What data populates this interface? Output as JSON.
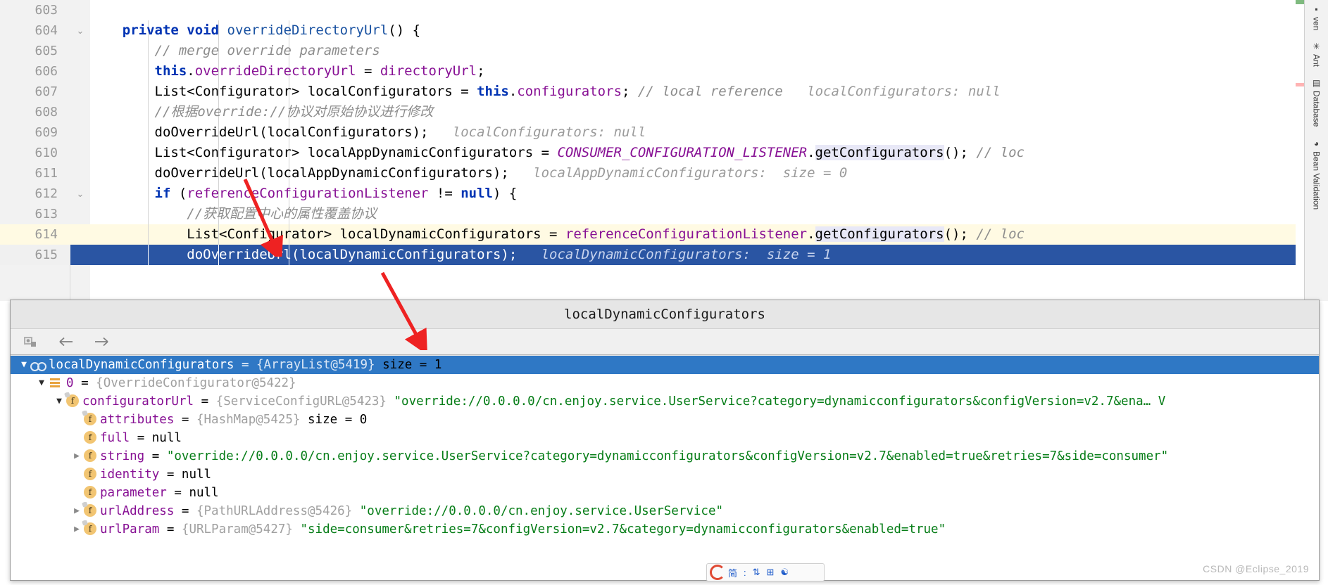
{
  "editor": {
    "lines": [
      {
        "num": "603",
        "state": "none",
        "tokens": []
      },
      {
        "num": "604",
        "state": "none",
        "fold": "minus",
        "tokens": [
          {
            "t": "    ",
            "c": "plain"
          },
          {
            "t": "private",
            "c": "kw2"
          },
          {
            "t": " ",
            "c": "plain"
          },
          {
            "t": "void",
            "c": "kw2"
          },
          {
            "t": " ",
            "c": "plain"
          },
          {
            "t": "overrideDirectoryUrl",
            "c": "meth"
          },
          {
            "t": "() {",
            "c": "plain"
          }
        ]
      },
      {
        "num": "605",
        "state": "none",
        "tokens": [
          {
            "t": "        ",
            "c": "plain"
          },
          {
            "t": "// merge override parameters",
            "c": "cmt"
          }
        ]
      },
      {
        "num": "606",
        "state": "none",
        "tokens": [
          {
            "t": "        ",
            "c": "plain"
          },
          {
            "t": "this",
            "c": "kw2"
          },
          {
            "t": ".",
            "c": "plain"
          },
          {
            "t": "overrideDirectoryUrl",
            "c": "fld"
          },
          {
            "t": " = ",
            "c": "plain"
          },
          {
            "t": "directoryUrl",
            "c": "fld"
          },
          {
            "t": ";",
            "c": "plain"
          }
        ]
      },
      {
        "num": "607",
        "state": "none",
        "tokens": [
          {
            "t": "        ",
            "c": "plain"
          },
          {
            "t": "List<Configurator> localConfigurators = ",
            "c": "plain"
          },
          {
            "t": "this",
            "c": "kw2"
          },
          {
            "t": ".",
            "c": "plain"
          },
          {
            "t": "configurators",
            "c": "fld"
          },
          {
            "t": "; ",
            "c": "plain"
          },
          {
            "t": "// local reference",
            "c": "cmt"
          },
          {
            "t": "   localConfigurators: null",
            "c": "hint"
          }
        ]
      },
      {
        "num": "608",
        "state": "none",
        "tokens": [
          {
            "t": "        ",
            "c": "plain"
          },
          {
            "t": "//根据override://协议对原始协议进行修改",
            "c": "cmt"
          }
        ]
      },
      {
        "num": "609",
        "state": "none",
        "tokens": [
          {
            "t": "        ",
            "c": "plain"
          },
          {
            "t": "doOverrideUrl(localConfigurators);",
            "c": "plain"
          },
          {
            "t": "   localConfigurators: null",
            "c": "hint"
          }
        ]
      },
      {
        "num": "610",
        "state": "none",
        "tokens": [
          {
            "t": "        ",
            "c": "plain"
          },
          {
            "t": "List<Configurator> localAppDynamicConfigurators = ",
            "c": "plain"
          },
          {
            "t": "CONSUMER_CONFIGURATION_LISTENER",
            "c": "stat"
          },
          {
            "t": ".",
            "c": "plain"
          },
          {
            "t": "getConfigurators",
            "c": "hl"
          },
          {
            "t": "(); ",
            "c": "plain"
          },
          {
            "t": "// loc",
            "c": "cmt"
          }
        ]
      },
      {
        "num": "611",
        "state": "none",
        "tokens": [
          {
            "t": "        ",
            "c": "plain"
          },
          {
            "t": "doOverrideUrl(localAppDynamicConfigurators);",
            "c": "plain"
          },
          {
            "t": "   localAppDynamicConfigurators:  size = 0",
            "c": "hint"
          }
        ]
      },
      {
        "num": "612",
        "state": "none",
        "fold": "tri",
        "tokens": [
          {
            "t": "        ",
            "c": "plain"
          },
          {
            "t": "if",
            "c": "kw2"
          },
          {
            "t": " (",
            "c": "plain"
          },
          {
            "t": "referenceConfigurationListener",
            "c": "fld"
          },
          {
            "t": " != ",
            "c": "plain"
          },
          {
            "t": "null",
            "c": "kw2"
          },
          {
            "t": ") {",
            "c": "plain"
          }
        ]
      },
      {
        "num": "613",
        "state": "none",
        "tokens": [
          {
            "t": "            ",
            "c": "plain"
          },
          {
            "t": "//获取配置中心的属性覆盖协议",
            "c": "cmt"
          }
        ]
      },
      {
        "num": "614",
        "state": "caret",
        "tokens": [
          {
            "t": "            ",
            "c": "plain"
          },
          {
            "t": "List<Configurator> localDynamicConfigurators = ",
            "c": "plain"
          },
          {
            "t": "referenceConfigurationListener",
            "c": "fld"
          },
          {
            "t": ".",
            "c": "plain"
          },
          {
            "t": "getConfigurators",
            "c": "hl"
          },
          {
            "t": "(); ",
            "c": "plain"
          },
          {
            "t": "// loc",
            "c": "cmt"
          }
        ]
      },
      {
        "num": "615",
        "state": "select",
        "tokens": [
          {
            "t": "            ",
            "c": "plain"
          },
          {
            "t": "doOverrideUrl(localDynamicConfigurators);",
            "c": "on-sel"
          },
          {
            "t": "   localDynamicConfigurators:  size = 1",
            "c": "hint-on-sel"
          }
        ]
      }
    ]
  },
  "right_strip": {
    "tabs": [
      {
        "label": "ven",
        "icon": "maven-icon"
      },
      {
        "label": "Ant",
        "icon": "ant-icon"
      },
      {
        "label": "Database",
        "icon": "database-icon"
      },
      {
        "label": "Bean Validation",
        "icon": "bean-icon"
      }
    ]
  },
  "popup": {
    "title": "localDynamicConfigurators",
    "toolbar": [
      {
        "name": "copy-value-button",
        "label": ""
      },
      {
        "name": "back-button",
        "label": ""
      },
      {
        "name": "forward-button",
        "label": ""
      }
    ],
    "tree": [
      {
        "indent": 0,
        "arrow": "open",
        "icon": "glasses-icon",
        "selected": true,
        "name": "localDynamicConfigurators",
        "eq": " = ",
        "type": "{ArrayList@5419}",
        "value": "  size = 1"
      },
      {
        "indent": 1,
        "arrow": "open",
        "icon": "list-icon",
        "selected": false,
        "name": "0",
        "eq": " = ",
        "type": "{OverrideConfigurator@5422}",
        "value": ""
      },
      {
        "indent": 2,
        "arrow": "open",
        "icon": "field-private-icon",
        "selected": false,
        "name": "configuratorUrl",
        "eq": " = ",
        "type": "{ServiceConfigURL@5423}",
        "value": " \"override://0.0.0.0/cn.enjoy.service.UserService?category=dynamicconfigurators&configVersion=v2.7&ena…  V"
      },
      {
        "indent": 3,
        "arrow": "none",
        "icon": "field-private-icon",
        "selected": false,
        "name": "attributes",
        "eq": " = ",
        "type": "{HashMap@5425}",
        "value": "  size = 0"
      },
      {
        "indent": 3,
        "arrow": "none",
        "icon": "field-icon",
        "selected": false,
        "name": "full",
        "eq": " = ",
        "type": "",
        "value": "null"
      },
      {
        "indent": 3,
        "arrow": "closed",
        "icon": "field-icon",
        "selected": false,
        "name": "string",
        "eq": " = ",
        "type": "",
        "value": "\"override://0.0.0.0/cn.enjoy.service.UserService?category=dynamicconfigurators&configVersion=v2.7&enabled=true&retries=7&side=consumer\""
      },
      {
        "indent": 3,
        "arrow": "none",
        "icon": "field-icon",
        "selected": false,
        "name": "identity",
        "eq": " = ",
        "type": "",
        "value": "null"
      },
      {
        "indent": 3,
        "arrow": "none",
        "icon": "field-icon",
        "selected": false,
        "name": "parameter",
        "eq": " = ",
        "type": "",
        "value": "null"
      },
      {
        "indent": 3,
        "arrow": "closed",
        "icon": "field-private-icon",
        "selected": false,
        "name": "urlAddress",
        "eq": " = ",
        "type": "{PathURLAddress@5426}",
        "value": " \"override://0.0.0.0/cn.enjoy.service.UserService\""
      },
      {
        "indent": 3,
        "arrow": "closed",
        "icon": "field-private-icon",
        "selected": false,
        "name": "urlParam",
        "eq": " = ",
        "type": "{URLParam@5427}",
        "value": " \"side=consumer&retries=7&configVersion=v2.7&category=dynamicconfigurators&enabled=true\""
      }
    ]
  },
  "watermark": "CSDN @Eclipse_2019",
  "ime": {
    "items": [
      "简",
      ":",
      "⇅",
      "⊞",
      "☯"
    ]
  },
  "colors": {
    "selection_blue": "#2a55a3",
    "tree_selection_blue": "#2f78c5",
    "caret_line": "#fffae3",
    "annotation_red": "#ee2222",
    "string_green": "#067d17",
    "field_purple": "#871094",
    "keyword_blue": "#0033b3"
  }
}
